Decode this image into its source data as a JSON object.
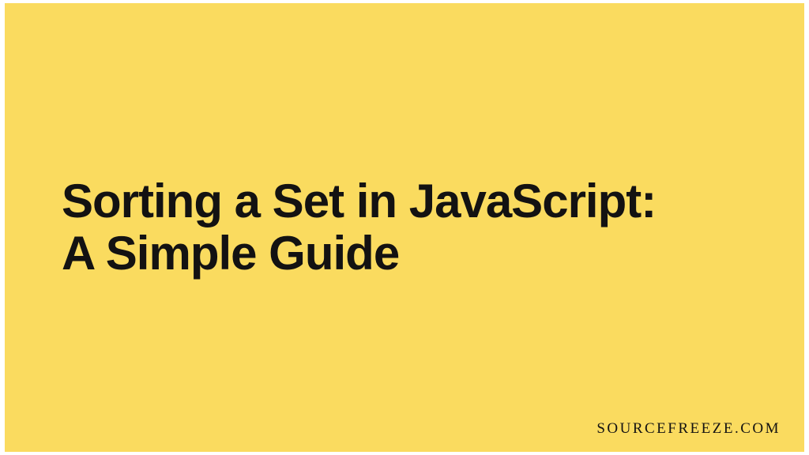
{
  "card": {
    "title_line1": "Sorting a Set in JavaScript:",
    "title_line2": "A Simple Guide",
    "attribution": "SOURCEFREEZE.COM"
  },
  "colors": {
    "background": "#fadb5f",
    "text": "#131212"
  }
}
